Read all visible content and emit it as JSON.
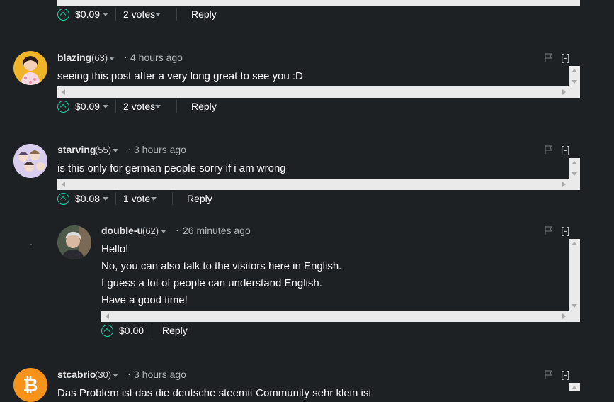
{
  "top_partial": {
    "payout": "$0.09",
    "votes": "2 votes",
    "reply": "Reply"
  },
  "comments": [
    {
      "username": "blazing",
      "rep": "(63)",
      "time": "4 hours ago",
      "body": [
        "seeing this post after a very long great to see you :D"
      ],
      "payout": "$0.09",
      "votes": "2 votes",
      "reply": "Reply",
      "collapse": "[-]",
      "avatar_color": "#f0b429"
    },
    {
      "username": "starving",
      "rep": "(55)",
      "time": "3 hours ago",
      "body": [
        "is this only for german people sorry if i am wrong"
      ],
      "payout": "$0.08",
      "votes": "1 vote",
      "reply": "Reply",
      "collapse": "[-]",
      "avatar_color": "#c9b8e8"
    },
    {
      "username": "double-u",
      "rep": "(62)",
      "time": "26 minutes ago",
      "body": [
        "Hello!",
        "No, you can also talk to the visitors here in English.",
        "I guess a lot of people can understand English.",
        "Have a good time!"
      ],
      "payout": "$0.00",
      "reply": "Reply",
      "collapse": "[-]",
      "avatar_color": "#7a7a6a"
    },
    {
      "username": "stcabrio",
      "rep": "(30)",
      "time": "3 hours ago",
      "body": [
        "Das Problem ist das die deutsche steemit Community sehr klein ist"
      ],
      "collapse": "[-]",
      "avatar_color": "#f7931a"
    }
  ],
  "colors": {
    "background": "#1e2124",
    "accent": "#06d6a9"
  }
}
